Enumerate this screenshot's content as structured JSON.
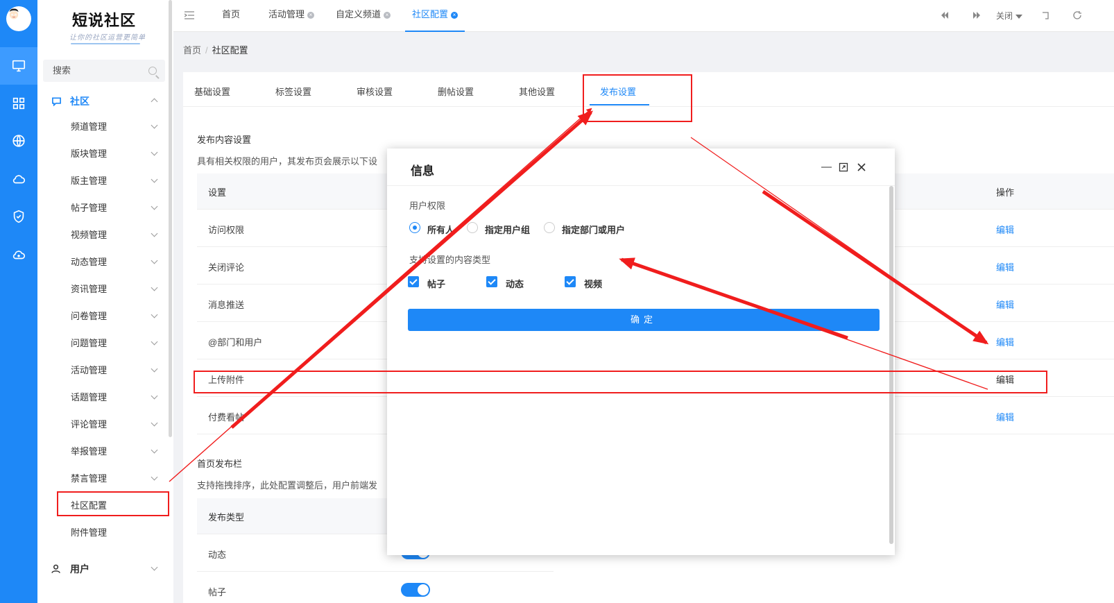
{
  "app": {
    "title": "短说社区",
    "subtitle": "让你的社区运营更简单"
  },
  "rail": {
    "items": [
      "monitor-icon",
      "grid-icon",
      "globe-icon",
      "cloud-icon",
      "shield-icon",
      "cloud-sync-icon"
    ]
  },
  "sidebar": {
    "search_label": "搜索",
    "group_community": "社区",
    "items": [
      "频道管理",
      "版块管理",
      "版主管理",
      "帖子管理",
      "视频管理",
      "动态管理",
      "资讯管理",
      "问卷管理",
      "问题管理",
      "活动管理",
      "话题管理",
      "评论管理",
      "举报管理",
      "禁言管理"
    ],
    "active_item": "社区配置",
    "after_item": "附件管理",
    "group_user": "用户"
  },
  "topbar": {
    "tabs": [
      {
        "label": "首页"
      },
      {
        "label": "活动管理",
        "close": "×"
      },
      {
        "label": "自定义频道",
        "close": "×"
      },
      {
        "label": "社区配置",
        "close": "×"
      }
    ],
    "close_label": "关闭"
  },
  "breadcrumb": {
    "home": "首页",
    "sep": "/",
    "current": "社区配置"
  },
  "subtabs": [
    "基础设置",
    "标签设置",
    "审核设置",
    "删帖设置",
    "其他设置",
    "发布设置"
  ],
  "publish": {
    "title": "发布内容设置",
    "desc": "具有相关权限的用户，其发布页会展示以下设",
    "col_setting": "设置",
    "col_action": "操作",
    "rows": [
      "访问权限",
      "关闭评论",
      "消息推送",
      "@部门和用户",
      "上传附件",
      "付费看帖"
    ],
    "edit_label": "编辑"
  },
  "home_bar": {
    "title": "首页发布栏",
    "desc": "支持拖拽排序，此处配置调整后，用户前端发",
    "col_type": "发布类型",
    "rows": [
      "动态",
      "帖子"
    ]
  },
  "modal": {
    "title": "信息",
    "permission_label": "用户权限",
    "radios": [
      "所有人",
      "指定用户组",
      "指定部门或用户"
    ],
    "types_label": "支持设置的内容类型",
    "checks": [
      "帖子",
      "动态",
      "视频"
    ],
    "confirm": "确定"
  },
  "colors": {
    "accent": "#1e88f7",
    "annotation": "#f01d1d"
  }
}
